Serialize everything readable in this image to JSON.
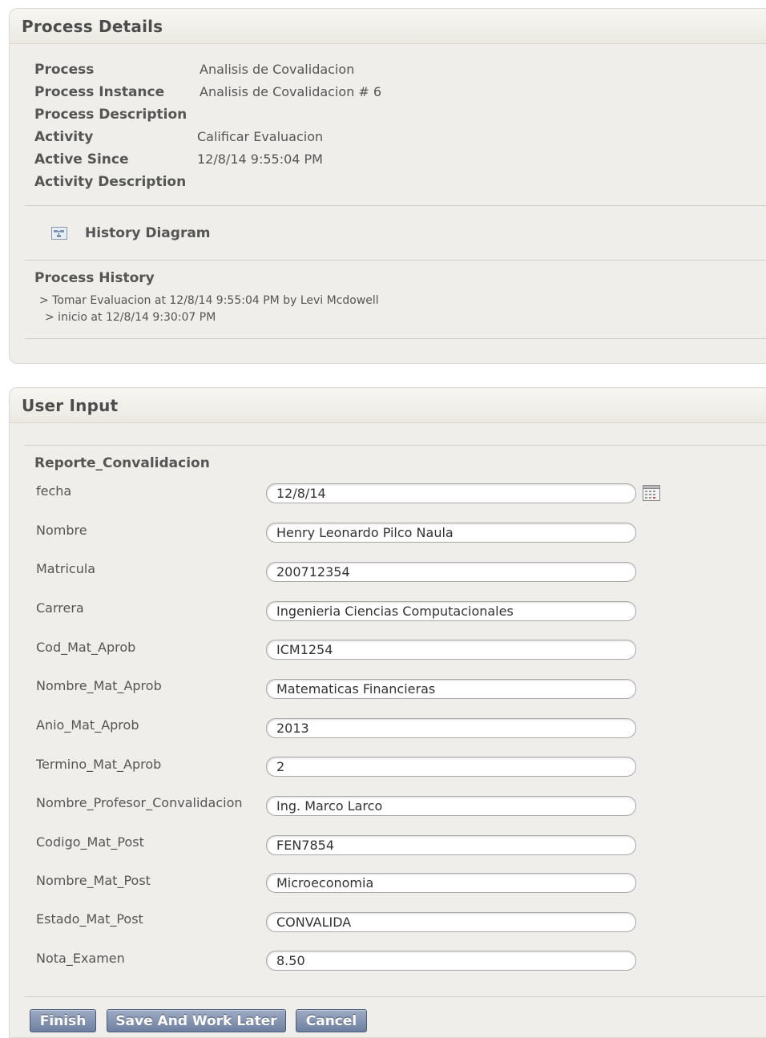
{
  "process_details": {
    "title": "Process Details",
    "rows": [
      {
        "label": "Process",
        "value": "Analisis de Covalidacion"
      },
      {
        "label": "Process Instance",
        "value": "Analisis de Covalidacion # 6"
      },
      {
        "label": "Process Description",
        "value": ""
      },
      {
        "label": "Activity",
        "value": "Calificar Evaluacion"
      },
      {
        "label": "Active Since",
        "value": "12/8/14 9:55:04 PM"
      },
      {
        "label": "Activity Description",
        "value": ""
      }
    ],
    "history_diagram": "History Diagram",
    "history_title": "Process History",
    "history": [
      "> Tomar Evaluacion at 12/8/14 9:55:04 PM by Levi Mcdowell",
      "> inicio at 12/8/14 9:30:07 PM"
    ]
  },
  "user_input": {
    "title": "User Input",
    "form_title": "Reporte_Convalidacion",
    "fields": [
      {
        "label": "fecha",
        "value": "12/8/14"
      },
      {
        "label": "Nombre",
        "value": "Henry Leonardo Pilco Naula"
      },
      {
        "label": "Matricula",
        "value": "200712354"
      },
      {
        "label": "Carrera",
        "value": "Ingenieria Ciencias Computacionales"
      },
      {
        "label": "Cod_Mat_Aprob",
        "value": "ICM1254"
      },
      {
        "label": "Nombre_Mat_Aprob",
        "value": "Matematicas Financieras"
      },
      {
        "label": "Anio_Mat_Aprob",
        "value": "2013"
      },
      {
        "label": "Termino_Mat_Aprob",
        "value": "2"
      },
      {
        "label": "Nombre_Profesor_Convalidacion",
        "value": "Ing. Marco Larco"
      },
      {
        "label": "Codigo_Mat_Post",
        "value": "FEN7854"
      },
      {
        "label": "Nombre_Mat_Post",
        "value": "Microeconomia"
      },
      {
        "label": "Estado_Mat_Post",
        "value": "CONVALIDA"
      },
      {
        "label": "Nota_Examen",
        "value": "8.50"
      }
    ]
  },
  "buttons": {
    "finish": "Finish",
    "save_later": "Save And Work Later",
    "cancel": "Cancel"
  },
  "icons": {
    "history_diagram": "diagram-icon",
    "date_picker": "calendar-icon"
  }
}
